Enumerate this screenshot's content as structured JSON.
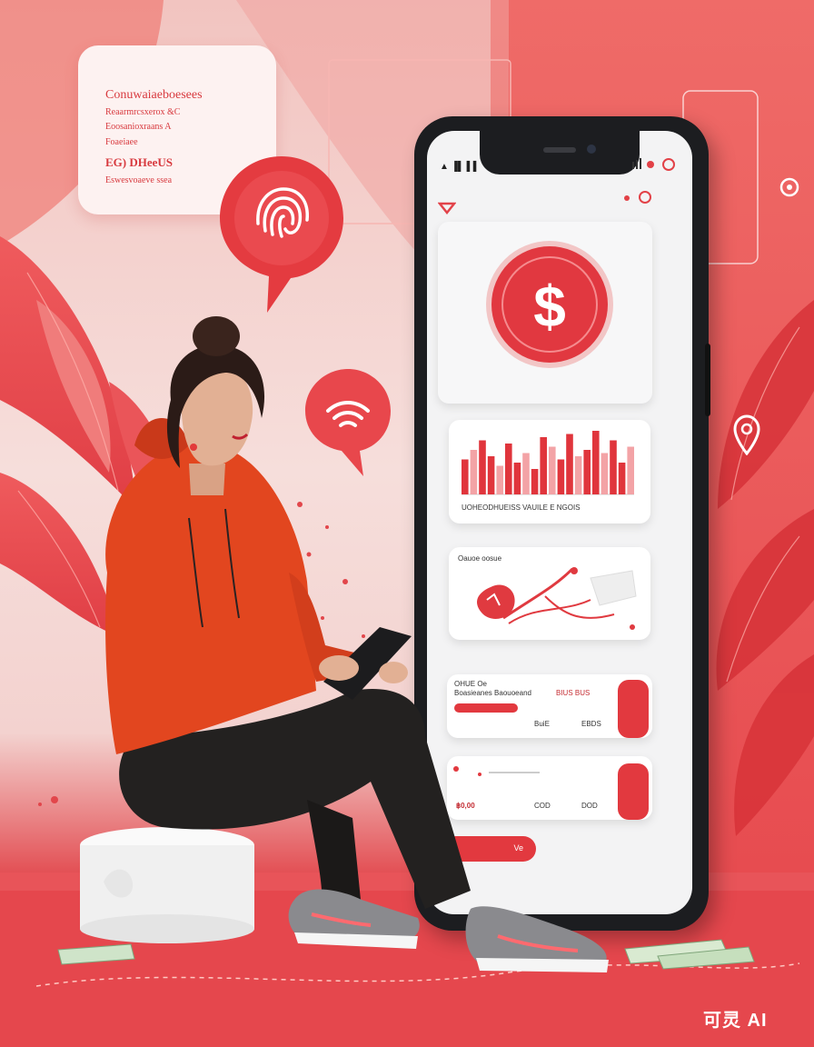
{
  "speech_bubble": {
    "lines": [
      "Conuwaiaeboesees",
      "Reaarmrcsxerox &C",
      "Eoosanioxraans A",
      "Foaeiaee",
      "EG) DHeeUS",
      "Eswesvoaeve ssea"
    ]
  },
  "phone": {
    "status_left": "▲ ▐▌ ▌▌",
    "chart_caption": "UOHEODHUEISS VAUILE E NGOIS",
    "card3_title": "Oauoe oosue",
    "row1_lines": [
      "OHUE Oe",
      "Boasieanes Baouoeand",
      "BIUS BUS"
    ],
    "row1_amount_left": "BuiE",
    "row1_amount_right": "EBDS",
    "row2_left": "฿0,00",
    "row2_mid": "COD",
    "row2_right": "DOD",
    "button_label": "Ve"
  },
  "watermark": "可灵 AI",
  "colors": {
    "accent": "#e5454a",
    "hoodie": "#e2461f",
    "pants": "#22201f",
    "screen": "#f3f3f4"
  },
  "icons": [
    "fingerprint-icon",
    "wifi-icon",
    "dollar-icon",
    "location-pin-icon",
    "bar-chart-icon",
    "pie-chart-icon"
  ],
  "chart_data": {
    "type": "bar",
    "values": [
      55,
      70,
      85,
      60,
      45,
      80,
      50,
      65,
      40,
      90,
      75,
      55,
      95,
      60,
      70,
      100,
      65,
      85,
      50,
      75
    ]
  }
}
